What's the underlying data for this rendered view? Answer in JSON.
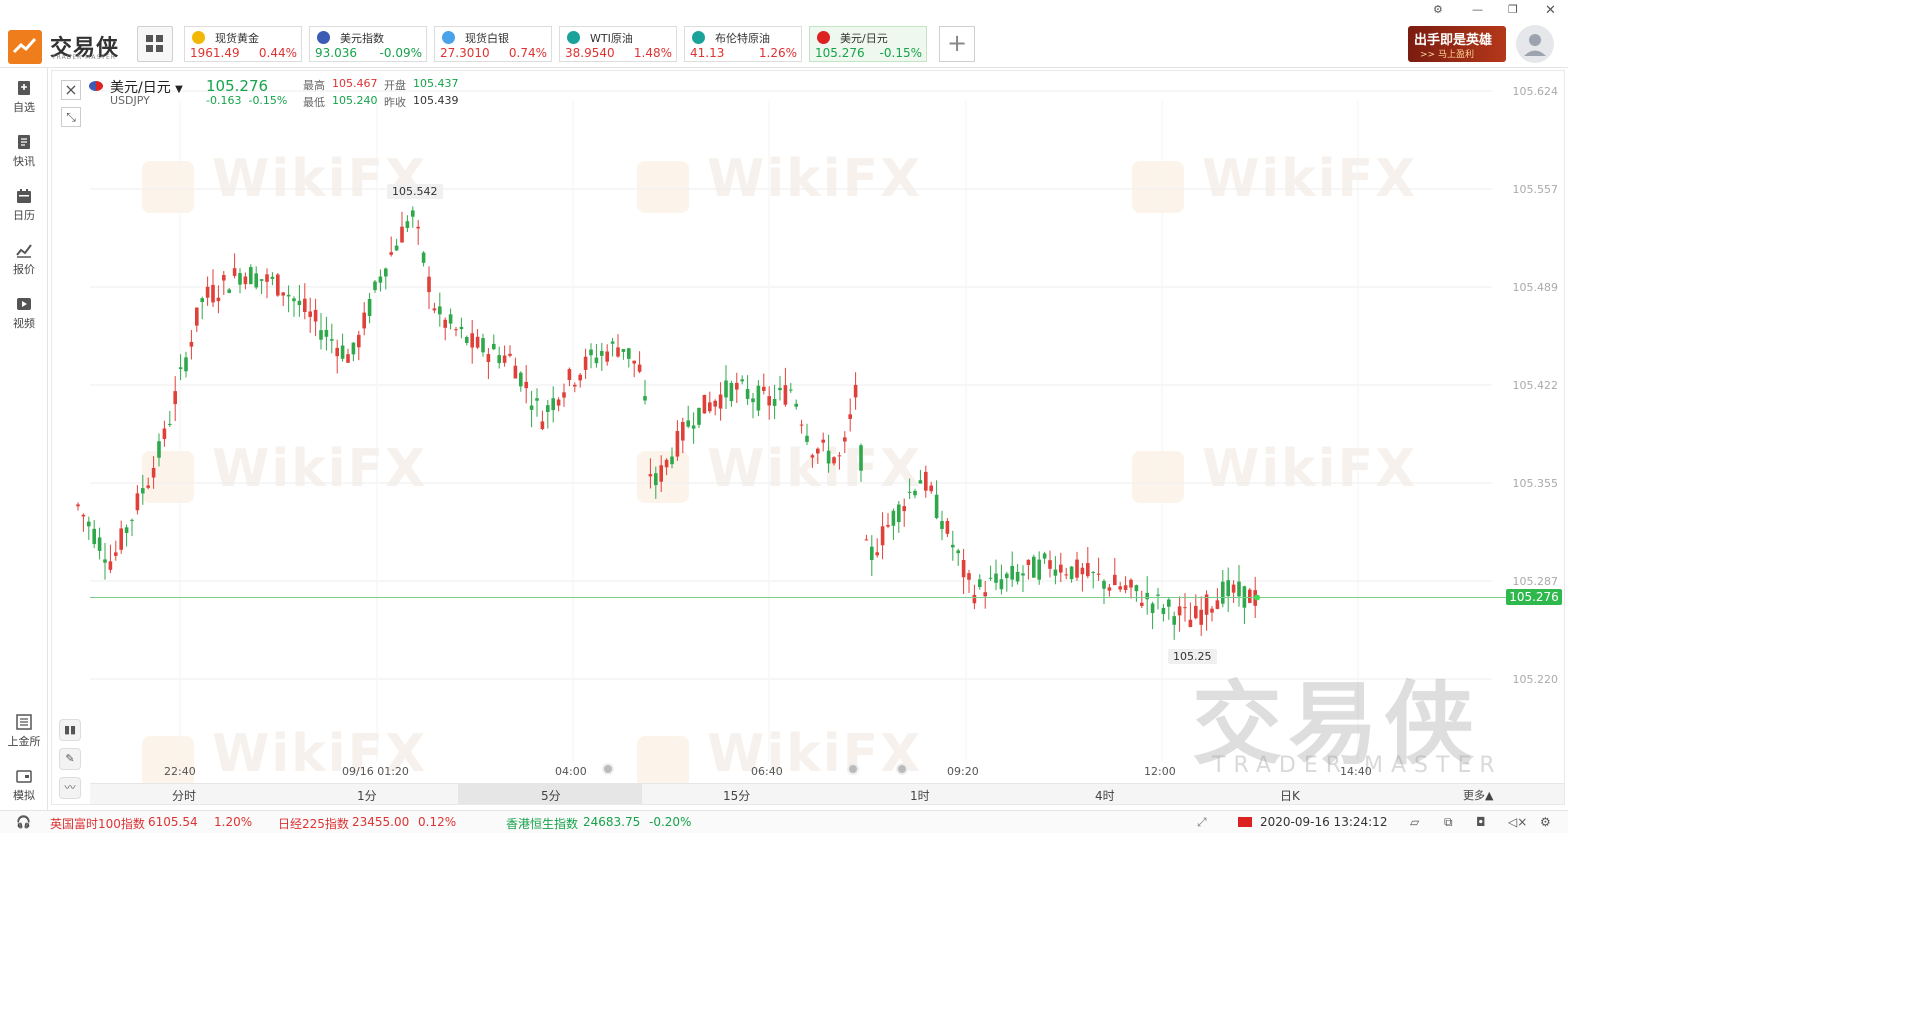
{
  "app": {
    "logo_text": "交易侠",
    "logo_sub": "TRADER MASTER"
  },
  "tickers": [
    {
      "name": "现货黄金",
      "price": "1961.49",
      "pct": "0.44%",
      "dir": "up",
      "icon_color": "#f2b705"
    },
    {
      "name": "美元指数",
      "price": "93.036",
      "pct": "-0.09%",
      "dir": "down",
      "icon_color": "#3b5bb5"
    },
    {
      "name": "现货白银",
      "price": "27.3010",
      "pct": "0.74%",
      "dir": "up",
      "icon_color": "#4aa3e8"
    },
    {
      "name": "WTI原油",
      "price": "38.9540",
      "pct": "1.48%",
      "dir": "up",
      "icon_color": "#1aa39a"
    },
    {
      "name": "布伦特原油",
      "price": "41.13",
      "pct": "1.26%",
      "dir": "up",
      "icon_color": "#1aa39a"
    },
    {
      "name": "美元/日元",
      "price": "105.276",
      "pct": "-0.15%",
      "dir": "down",
      "icon_color": "#d22"
    }
  ],
  "banner": {
    "line1": "出手即是英雄",
    "line2": ">> 马上盈利"
  },
  "sidebar": {
    "items": [
      {
        "label": "自选",
        "icon": "bookmark-icon"
      },
      {
        "label": "快讯",
        "icon": "news-icon"
      },
      {
        "label": "日历",
        "icon": "calendar-icon"
      },
      {
        "label": "报价",
        "icon": "quote-icon"
      },
      {
        "label": "视频",
        "icon": "video-icon"
      }
    ],
    "bottom_items": [
      {
        "label": "上金所",
        "icon": "exchange-icon"
      },
      {
        "label": "模拟",
        "icon": "simulate-icon"
      }
    ]
  },
  "symbol": {
    "name": "美元/日元",
    "code": "USDJPY",
    "price": "105.276",
    "change": "-0.163",
    "change_pct": "-0.15%",
    "high_label": "最高",
    "high": "105.467",
    "open_label": "开盘",
    "open": "105.437",
    "low_label": "最低",
    "low": "105.240",
    "prev_label": "昨收",
    "prev": "105.439"
  },
  "chart_data": {
    "type": "candlestick",
    "y_axis": [
      "105.624",
      "105.557",
      "105.489",
      "105.422",
      "105.355",
      "105.287",
      "105.220"
    ],
    "x_axis": [
      "22:40",
      "09/16 01:20",
      "04:00",
      "06:40",
      "09:20",
      "12:00",
      "14:40"
    ],
    "max_label": "105.542",
    "min_label": "105.25",
    "last_price": "105.276",
    "ylim": [
      105.2,
      105.64
    ]
  },
  "periods": [
    "分时",
    "1分",
    "5分",
    "15分",
    "1时",
    "4时",
    "日K",
    "更多▲"
  ],
  "active_period": "5分",
  "watermark": "WikiFX",
  "big_watermark": "交易侠",
  "big_watermark_sub": "TRADER MASTER",
  "bottom": {
    "items": [
      {
        "name": "英国富时100指数",
        "value": "6105.54",
        "pct": "1.20%"
      },
      {
        "name": "日经225指数",
        "value": "23455.00",
        "pct": "0.12%"
      },
      {
        "name": "香港恒生指数",
        "value": "24683.75",
        "pct": "-0.20%"
      }
    ],
    "datetime": "2020-09-16 13:24:12"
  }
}
